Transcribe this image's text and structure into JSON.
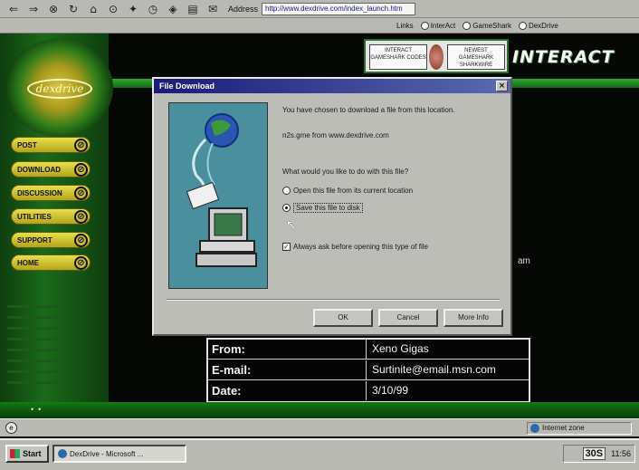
{
  "browser": {
    "address_label": "Address",
    "address_value": "http://www.dexdrive.com/index_launch.htm",
    "links_label": "Links",
    "links": [
      "InterAct",
      "GameShark",
      "DexDrive"
    ],
    "nav_icons": [
      "back-icon",
      "forward-icon",
      "stop-icon",
      "refresh-icon",
      "home-icon",
      "search-icon",
      "favorites-icon",
      "history-icon",
      "channels-icon",
      "print-icon",
      "mail-icon"
    ]
  },
  "site": {
    "logo_text": "dexdrive",
    "nav_buttons": [
      "POST",
      "DOWNLOAD",
      "DISCUSSION",
      "UTILITIES",
      "SUPPORT",
      "HOME"
    ],
    "banner_ad": {
      "left_text": "INTERACT GAMESHARK CODES",
      "right_text": "NEWEST GAMESHARK SHARKWIRE"
    },
    "interact_logo": "INTERACT",
    "info_rows": [
      {
        "label": "From:",
        "value": "Xeno Gigas"
      },
      {
        "label": "E-mail:",
        "value": "Surtinite@email.msn.com"
      },
      {
        "label": "Date:",
        "value": "3/10/99"
      }
    ],
    "side_fragment": "am"
  },
  "dialog": {
    "title": "File Download",
    "close_glyph": "×",
    "message_line1": "You have chosen to download a file from this location.",
    "file_source": "n2s.gme from www.dexdrive.com",
    "question": "What would you like to do with this file?",
    "option_open": "Open this file from its current location",
    "option_save": "Save this file to disk",
    "selected_option": "save",
    "always_ask_label": "Always ask before opening this type of file",
    "always_ask_checked": true,
    "buttons": {
      "ok": "OK",
      "cancel": "Cancel",
      "more_info": "More Info"
    }
  },
  "status_bar": {
    "zone": "Internet zone"
  },
  "taskbar": {
    "start": "Start",
    "task": "DexDrive - Microsoft ...",
    "tv_logo": "30S",
    "clock": "11:56"
  }
}
